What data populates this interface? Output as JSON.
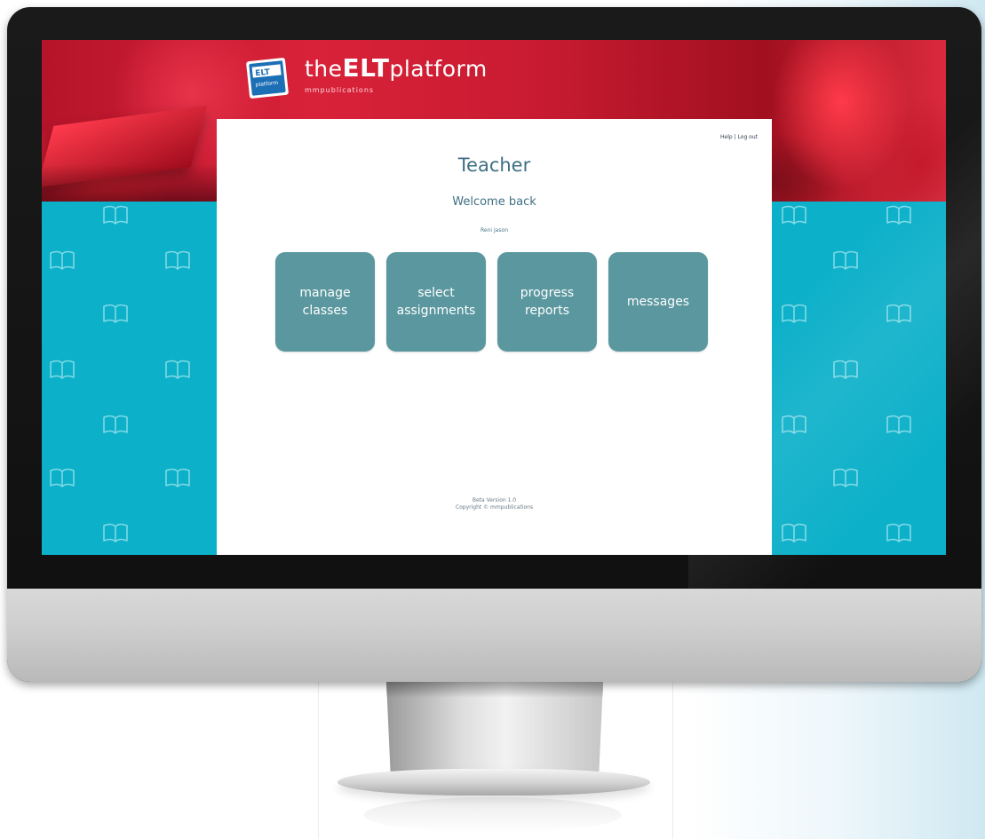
{
  "brand": {
    "logo_text": "ELT platform",
    "name_prefix": "the",
    "name_bold": "ELT",
    "name_suffix": "platform",
    "publisher": "mmpublications"
  },
  "header_links": {
    "help": "Help",
    "separator": "|",
    "logout": "Log out"
  },
  "page": {
    "title": "Teacher",
    "welcome": "Welcome back",
    "user_name": "Reni Jason"
  },
  "tiles": [
    {
      "label": "manage\nclasses"
    },
    {
      "label": "select\nassignments"
    },
    {
      "label": "progress\nreports"
    },
    {
      "label": "messages"
    }
  ],
  "footer": {
    "version": "Beta Version 1.0",
    "copyright": "Copyright © mmpublications"
  },
  "colors": {
    "teal_background": "#0cb0c9",
    "tile": "#5a979f",
    "title_text": "#3f6f83",
    "hero_red": "#d92239"
  },
  "icons": {
    "background_pattern": "open-book-icon"
  }
}
